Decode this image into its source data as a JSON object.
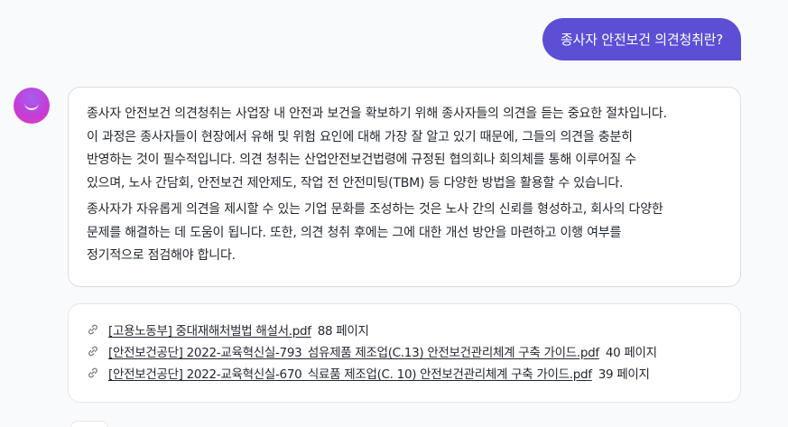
{
  "user_message": {
    "text": "종사자 안전보건 의견청취란?"
  },
  "assistant": {
    "paragraphs": [
      "종사자 안전보건 의견청취는 사업장 내 안전과 보건을 확보하기 위해 종사자들의 의견을 듣는 중요한 절차입니다.\n이 과정은 종사자들이 현장에서 유해 및 위험 요인에 대해 가장 잘 알고 있기 때문에, 그들의 의견을 충분히\n반영하는 것이 필수적입니다. 의견 청취는 산업안전보건법령에 규정된 협의회나 회의체를 통해 이루어질 수\n있으며, 노사 간담회, 안전보건 제안제도, 작업 전 안전미팅(TBM) 등 다양한 방법을 활용할 수 있습니다.",
      "종사자가 자유롭게 의견을 제시할 수 있는 기업 문화를 조성하는 것은 노사 간의 신뢰를 형성하고, 회사의 다양한\n문제를 해결하는 데 도움이 됩니다. 또한, 의견 청취 후에는 그에 대한 개선 방안을 마련하고 이행 여부를\n정기적으로 점검해야 합니다."
    ]
  },
  "references": [
    {
      "title": "[고용노동부] 중대재해처벌법 해설서.pdf",
      "pages": "88 페이지"
    },
    {
      "title": "[안전보건공단] 2022-교육혁신실-793_섬유제품 제조업(C.13) 안전보건관리체계 구축 가이드.pdf",
      "pages": "40 페이지"
    },
    {
      "title": "[안전보건공단] 2022-교육혁신실-670_식료품 제조업(C. 10) 안전보건관리체계 구축 가이드.pdf",
      "pages": "39 페이지"
    }
  ],
  "icons": {
    "avatar": "assistant-avatar-icon",
    "reference": "link-icon"
  },
  "colors": {
    "user_bubble": "#5b4fd6",
    "avatar_gradient_start": "#a55ef0",
    "avatar_gradient_end": "#e23ab8",
    "background": "#f9fafb"
  }
}
